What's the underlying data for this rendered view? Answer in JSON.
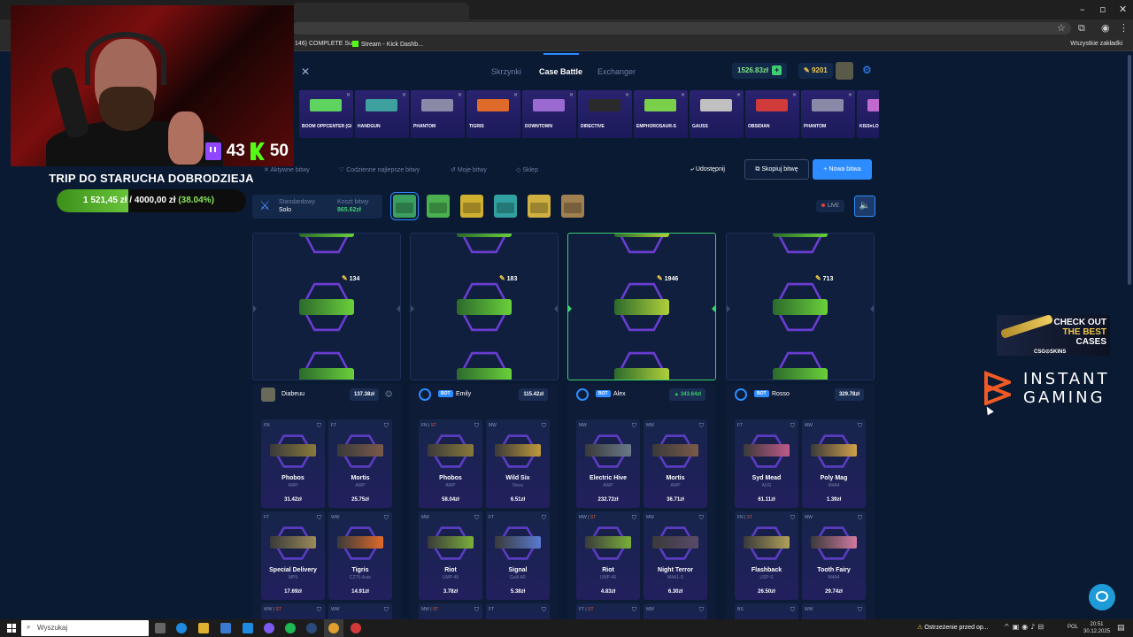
{
  "browser": {
    "bookmarks": [
      {
        "label": "146) COMPLETE Su..."
      },
      {
        "label": "Stream - Kick Dashb..."
      }
    ],
    "all_bookmarks_label": "Wszystkie zakładki",
    "window_controls": [
      "–",
      "▫",
      "✕"
    ]
  },
  "webcam": {
    "twitch_viewers": "43",
    "kick_viewers": "50"
  },
  "goal": {
    "title": "TRIP DO STARUCHA DOBRODZIEJA",
    "current": "1 521,45 zł",
    "separator": "/",
    "target": "4000,00 zł",
    "percent_text": "(38.04%)",
    "progress": 0.3804
  },
  "site": {
    "nav": [
      {
        "label": "Skrzynki",
        "active": false
      },
      {
        "label": "Case Battle",
        "active": true
      },
      {
        "label": "Exchanger",
        "active": false
      }
    ],
    "balance": "1526.83zł",
    "coins": "9201"
  },
  "drops": [
    {
      "name": "BOOM OPPCENTER (GLITTER)",
      "color": "#5fd35f"
    },
    {
      "name": "HANDGUN",
      "color": "#3fa0a0"
    },
    {
      "name": "PHANTOM",
      "color": "#8a8aa8"
    },
    {
      "name": "TIGRIS",
      "color": "#e06a2a"
    },
    {
      "name": "DOWNTOWN",
      "color": "#9a6ad0"
    },
    {
      "name": "DIRECTIVE",
      "color": "#2a2a2a"
    },
    {
      "name": "EMPHOROSAUR-S",
      "color": "#7ad04a"
    },
    {
      "name": "GAUSS",
      "color": "#c0c0c0"
    },
    {
      "name": "OBSIDIAN",
      "color": "#d03a3a"
    },
    {
      "name": "PHANTOM",
      "color": "#8a8aa8"
    },
    {
      "name": "KISS♥LO",
      "color": "#c06ad0"
    }
  ],
  "toolbar": {
    "active_battles": "Aktywne bitwy",
    "daily_best": "Codzienne najlepsze bitwy",
    "my_battles": "Moje bitwy",
    "shop": "Sklep",
    "share": "Udostępnij",
    "copy": "Skopiuj bitwę",
    "new": "+ Nowa bitwa"
  },
  "battle": {
    "mode_label": "Standardowy",
    "mode_value": "Solo",
    "cost_label": "Koszt bitwy",
    "cost_value": "865.62zł",
    "live": "LIVE",
    "cases": [
      {
        "color": "#3aa060"
      },
      {
        "color": "#4ab050"
      },
      {
        "color": "#d0b030"
      },
      {
        "color": "#30a0a0"
      },
      {
        "color": "#d0b040"
      },
      {
        "color": "#a08050"
      }
    ]
  },
  "spinners": [
    {
      "value": "134",
      "winner": false,
      "color": "#6ad03a"
    },
    {
      "value": "183",
      "winner": false,
      "color": "#6ad03a"
    },
    {
      "value": "1946",
      "winner": true,
      "color": "#b0d03a"
    },
    {
      "value": "713",
      "winner": false,
      "color": "#6ad03a"
    }
  ],
  "players": [
    {
      "name": "Diabeuu",
      "bot": false,
      "total": "137.38zł",
      "total_up": false,
      "items": [
        {
          "cond": "FN",
          "st": "",
          "name": "Phobos",
          "type": "AWP",
          "price": "31.42zł",
          "color": "#8a7a3a"
        },
        {
          "cond": "FT",
          "st": "",
          "name": "Mortis",
          "type": "AWP",
          "price": "25.75zł",
          "color": "#7a5a4a"
        },
        {
          "cond": "FT",
          "st": "",
          "name": "Special Delivery",
          "type": "MP9",
          "price": "17.69zł",
          "color": "#9a8a5a"
        },
        {
          "cond": "WW",
          "st": "",
          "name": "Tigris",
          "type": "CZ75-Auto",
          "price": "14.91zł",
          "color": "#e06a2a"
        }
      ],
      "more": [
        {
          "cond": "WW",
          "st": "ST"
        },
        {
          "cond": "WW",
          "st": ""
        }
      ]
    },
    {
      "name": "Emily",
      "bot": true,
      "total": "115.42zł",
      "total_up": false,
      "items": [
        {
          "cond": "FN",
          "st": "ST",
          "name": "Phobos",
          "type": "AWP",
          "price": "58.04zł",
          "color": "#8a7a3a"
        },
        {
          "cond": "MW",
          "st": "",
          "name": "Wild Six",
          "type": "Nova",
          "price": "6.51zł",
          "color": "#c09a3a"
        },
        {
          "cond": "MW",
          "st": "",
          "name": "Riot",
          "type": "UMP-45",
          "price": "3.78zł",
          "color": "#7ab03a"
        },
        {
          "cond": "FT",
          "st": "",
          "name": "Signal",
          "type": "Galil AR",
          "price": "5.38zł",
          "color": "#5a7ad0"
        }
      ],
      "more": [
        {
          "cond": "MW",
          "st": "ST"
        },
        {
          "cond": "FT",
          "st": ""
        }
      ]
    },
    {
      "name": "Alex",
      "bot": true,
      "total": "343.64zł",
      "total_up": true,
      "items": [
        {
          "cond": "MW",
          "st": "",
          "name": "Electric Hive",
          "type": "AWP",
          "price": "232.72zł",
          "color": "#6a7a8a"
        },
        {
          "cond": "MW",
          "st": "",
          "name": "Mortis",
          "type": "AWP",
          "price": "36.71zł",
          "color": "#7a5a4a"
        },
        {
          "cond": "MW",
          "st": "ST",
          "name": "Riot",
          "type": "UMP-45",
          "price": "4.83zł",
          "color": "#7ab03a"
        },
        {
          "cond": "MW",
          "st": "",
          "name": "Night Terror",
          "type": "M4A1-S",
          "price": "6.30zł",
          "color": "#5a4a6a"
        }
      ],
      "more": [
        {
          "cond": "FT",
          "st": "ST"
        },
        {
          "cond": "MW",
          "st": ""
        }
      ]
    },
    {
      "name": "Rosso",
      "bot": true,
      "total": "329.78zł",
      "total_up": false,
      "items": [
        {
          "cond": "FT",
          "st": "",
          "name": "Syd Mead",
          "type": "AUG",
          "price": "61.11zł",
          "color": "#c05a8a"
        },
        {
          "cond": "MW",
          "st": "",
          "name": "Poly Mag",
          "type": "M4A4",
          "price": "1.39zł",
          "color": "#d0a04a"
        },
        {
          "cond": "FN",
          "st": "ST",
          "name": "Flashback",
          "type": "USP-S",
          "price": "26.50zł",
          "color": "#b0a05a"
        },
        {
          "cond": "MW",
          "st": "",
          "name": "Tooth Fairy",
          "type": "M4A4",
          "price": "29.74zł",
          "color": "#d07aa0"
        }
      ],
      "more": [
        {
          "cond": "BS",
          "st": ""
        },
        {
          "cond": "WW",
          "st": ""
        }
      ]
    }
  ],
  "ads": {
    "csg_line1": "CHECK OUT",
    "csg_line2": "THE BEST",
    "csg_line3": "CASES",
    "csg_logo": "CSG⊙SKINS",
    "ig_line1": "INSTANT",
    "ig_line2": "GAMING"
  },
  "taskbar": {
    "search_placeholder": "Wyszukaj",
    "warning": "Ostrzeżenie przed op...",
    "lang": "POL",
    "time": "20:51",
    "date": "30.12.2025"
  }
}
